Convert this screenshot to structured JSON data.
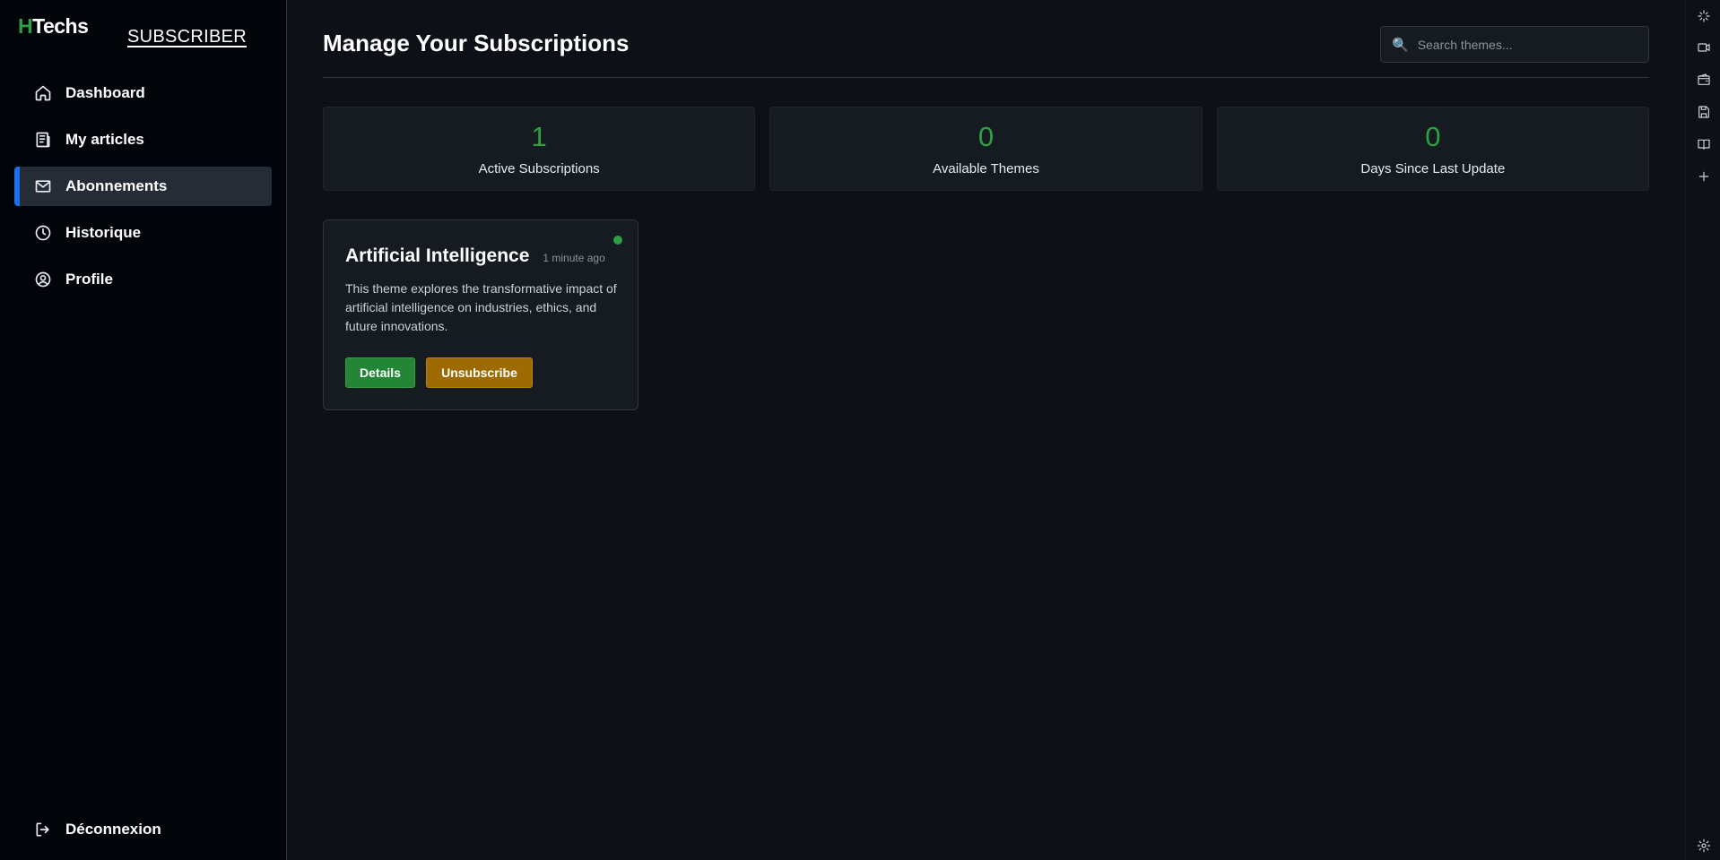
{
  "brand": {
    "logo_prefix": "H",
    "logo_rest": "Techs",
    "role": "SUBSCRIBER"
  },
  "sidebar": {
    "items": [
      {
        "label": "Dashboard",
        "icon": "home-icon"
      },
      {
        "label": "My articles",
        "icon": "articles-icon"
      },
      {
        "label": "Abonnements",
        "icon": "mail-icon",
        "active": true
      },
      {
        "label": "Historique",
        "icon": "clock-icon"
      },
      {
        "label": "Profile",
        "icon": "user-circle-icon"
      }
    ],
    "logout_label": "Déconnexion"
  },
  "header": {
    "title": "Manage Your Subscriptions",
    "search_placeholder": "Search themes...",
    "search_icon": "🔍"
  },
  "stats": [
    {
      "value": "1",
      "label": "Active Subscriptions"
    },
    {
      "value": "0",
      "label": "Available Themes"
    },
    {
      "value": "0",
      "label": "Days Since Last Update"
    }
  ],
  "subscriptions": [
    {
      "title": "Artificial Intelligence",
      "time": "1 minute ago",
      "description": "This theme explores the transformative impact of artificial intelligence on industries, ethics, and future innovations.",
      "details_label": "Details",
      "unsubscribe_label": "Unsubscribe",
      "status_color": "#2ea043"
    }
  ],
  "colors": {
    "accent": "#1f6feb",
    "success": "#2ea043",
    "warning": "#9e6a03"
  },
  "rail": {
    "icons": [
      "sparkle-icon",
      "video-icon",
      "wallet-icon",
      "save-icon",
      "book-icon",
      "plus-icon",
      "settings-icon"
    ]
  }
}
